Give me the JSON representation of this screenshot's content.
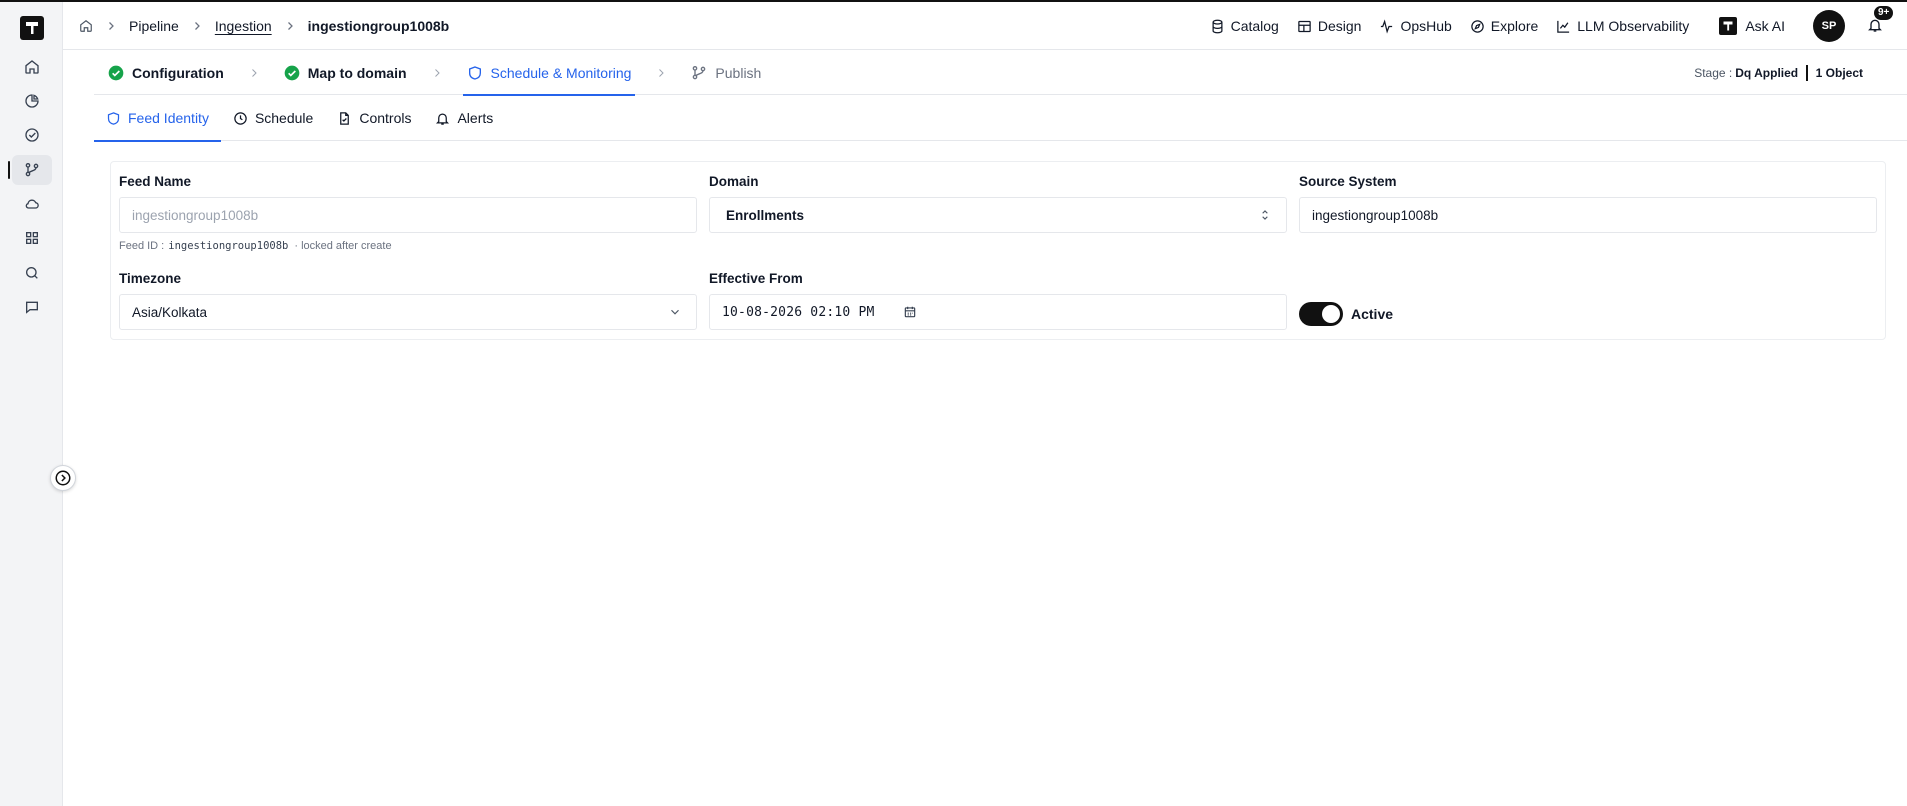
{
  "header": {
    "breadcrumbs": [
      "Pipeline",
      "Ingestion",
      "ingestiongroup1008b"
    ],
    "nav": [
      "Catalog",
      "Design",
      "OpsHub",
      "Explore",
      "LLM Observability"
    ],
    "ask_ai": "Ask AI",
    "avatar": "SP",
    "notifications": "9+"
  },
  "steps": [
    {
      "label": "Configuration",
      "state": "done"
    },
    {
      "label": "Map to domain",
      "state": "done"
    },
    {
      "label": "Schedule & Monitoring",
      "state": "current"
    },
    {
      "label": "Publish",
      "state": "pending"
    }
  ],
  "stage": {
    "label": "Stage :",
    "value": "Dq Applied",
    "objects": "1 Object"
  },
  "tabs": [
    "Feed Identity",
    "Schedule",
    "Controls",
    "Alerts"
  ],
  "form": {
    "feed_name": {
      "label": "Feed Name",
      "value": "ingestiongroup1008b",
      "hint_prefix": "Feed ID :",
      "hint_id": "ingestiongroup1008b",
      "hint_suffix": "· locked after create"
    },
    "domain": {
      "label": "Domain",
      "value": "Enrollments"
    },
    "source_system": {
      "label": "Source System",
      "value": "ingestiongroup1008b"
    },
    "timezone": {
      "label": "Timezone",
      "value": "Asia/Kolkata"
    },
    "effective_from": {
      "label": "Effective From",
      "value": "10-08-2026 02:10 PM"
    },
    "active": {
      "label": "Active",
      "on": true
    }
  },
  "colors": {
    "accent": "#2563eb",
    "success": "#16a34a",
    "dark": "#111111"
  }
}
